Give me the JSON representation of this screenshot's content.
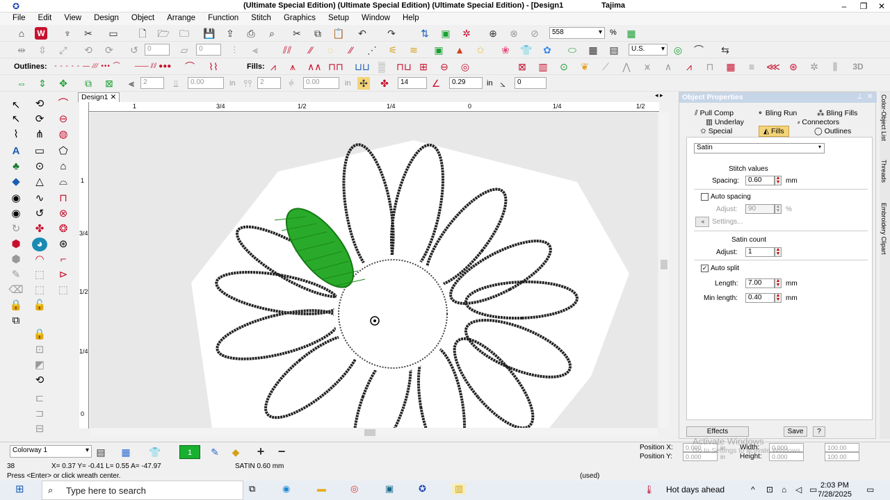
{
  "window": {
    "title": "(Ultimate Special Edition) (Ultimate Special Edition) (Ultimate Special Edition) - [Design1",
    "title_right": "Tajima"
  },
  "menu": [
    "File",
    "Edit",
    "View",
    "Design",
    "Object",
    "Arrange",
    "Function",
    "Stitch",
    "Graphics",
    "Setup",
    "Window",
    "Help"
  ],
  "toolbar": {
    "zoom_value": "558",
    "zoom_unit": "%",
    "units": "U.S.",
    "field_a": "0",
    "field_b": "0"
  },
  "toolbar3": {
    "outlines_label": "Outlines:",
    "fills_label": "Fills:"
  },
  "toolbar4": {
    "v1": "2",
    "v2": "0.00",
    "in1": "in",
    "v3": "2",
    "v4": "0.00",
    "in2": "in",
    "v5": "14",
    "v6": "0.29",
    "in3": "in",
    "v7": "0"
  },
  "doc_tab": {
    "label": "Design1",
    "close": "✕"
  },
  "ruler_h": [
    "1",
    "3/4",
    "1/2",
    "1/4",
    "0",
    "1/4",
    "1/2"
  ],
  "ruler_v": [
    "1",
    "3/4",
    "1/2",
    "1/4",
    "0"
  ],
  "props": {
    "title": "Object Properties",
    "tabs": {
      "pull_comp": "Pull Comp",
      "bling_run": "Bling Run",
      "bling_fills": "Bling Fills",
      "underlay": "Underlay",
      "connectors": "Connectors",
      "special": "Special",
      "fills": "Fills",
      "outlines": "Outlines"
    },
    "fill_type": "Satin",
    "stitch_values": "Stitch values",
    "spacing_label": "Spacing:",
    "spacing_value": "0.60",
    "mm1": "mm",
    "auto_spacing": "Auto spacing",
    "adjust_label": "Adjust:",
    "adjust_value": "90",
    "pct": "%",
    "settings": "Settings...",
    "satin_count": "Satin count",
    "adjust2_label": "Adjust:",
    "adjust2_value": "1",
    "auto_split": "Auto split",
    "length_label": "Length:",
    "length_value": "7.00",
    "mm2": "mm",
    "minlength_label": "Min length:",
    "minlength_value": "0.40",
    "mm3": "mm",
    "effects": "Effects",
    "save": "Save",
    "help": "?"
  },
  "right_strip": [
    "Color-Object List",
    "Threads",
    "Embroidery Clipart"
  ],
  "bottom": {
    "colorway": "Colorway 1",
    "color_num": "1",
    "posx_label": "Position X:",
    "posx": "0.000",
    "posy_label": "Position Y:",
    "posy": "0.000",
    "in": "in",
    "width_label": "Width:",
    "width": "0.000",
    "height_label": "Height:",
    "height": "0.000",
    "scale_w": "100.00",
    "scale_h": "100.00",
    "watermark1": "Activate Windows",
    "watermark2": "Go to Settings to activate Windows."
  },
  "status": {
    "count": "38",
    "coords": "X=  0.37 Y=  -0.41 L=  0.55 A= -47.97",
    "stitch": "SATIN  0.60 mm",
    "prompt": "Press <Enter> or click wreath center.",
    "used": "(used)"
  },
  "taskbar": {
    "search": "Type here to search",
    "weather": "Hot days ahead",
    "time": "2:03 PM",
    "date": "7/28/2025"
  }
}
